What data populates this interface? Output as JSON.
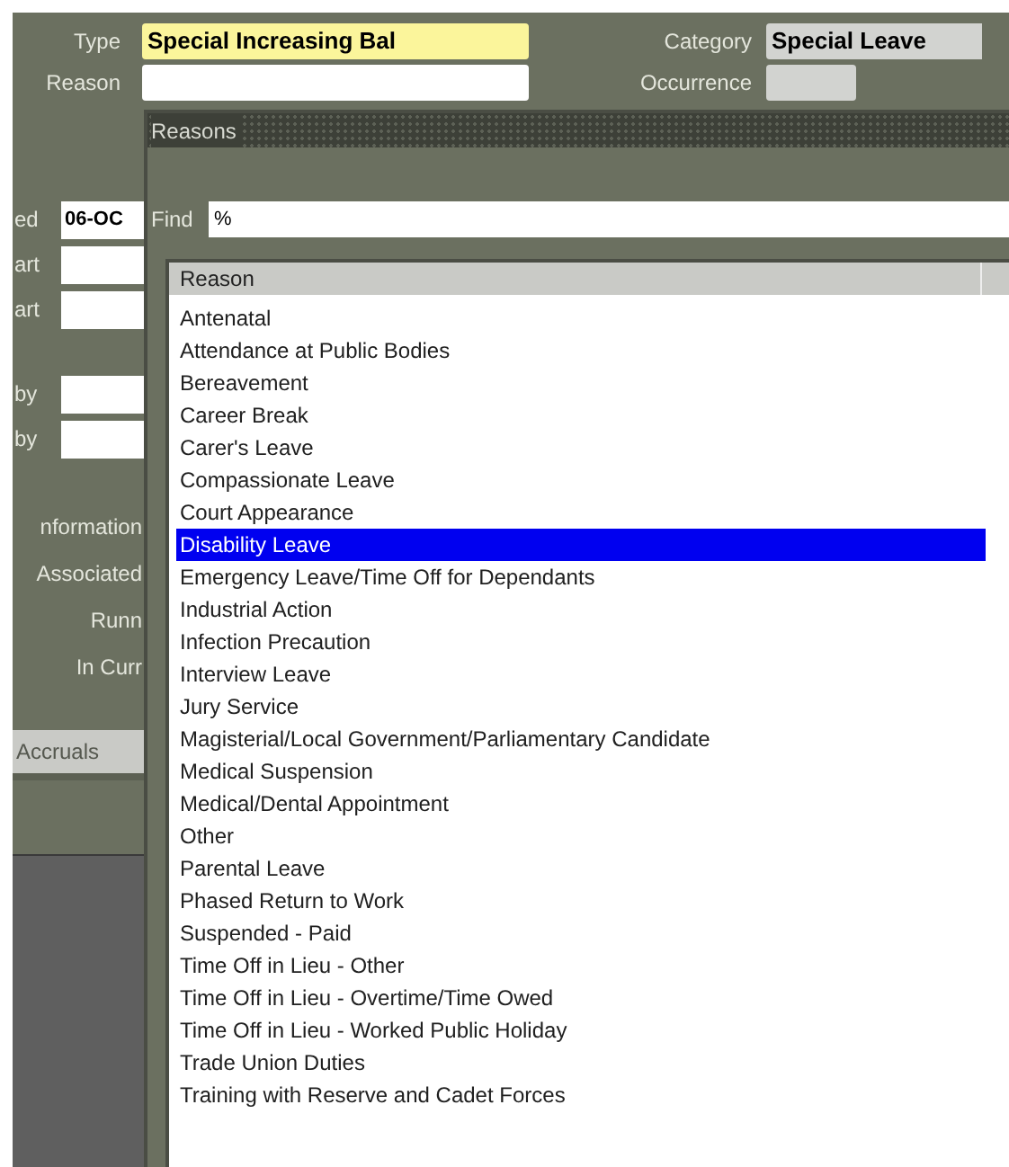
{
  "header": {
    "type_label": "Type",
    "type_value": "Special Increasing Bal",
    "category_label": "Category",
    "category_value": "Special Leave",
    "reason_label": "Reason",
    "occurrence_label": "Occurrence"
  },
  "left_panel": {
    "fields": [
      {
        "kind": "field",
        "label": "ed",
        "value": "06-OC"
      },
      {
        "kind": "field",
        "label": "art"
      },
      {
        "kind": "field",
        "label": "art"
      },
      {
        "kind": "gap"
      },
      {
        "kind": "field",
        "label": "by"
      },
      {
        "kind": "field",
        "label": "by"
      },
      {
        "kind": "gap"
      },
      {
        "kind": "text",
        "label": "nformation"
      },
      {
        "kind": "text",
        "label": "Associated"
      },
      {
        "kind": "text",
        "label": "Runn"
      },
      {
        "kind": "text",
        "label": "In Curr"
      }
    ],
    "tab": "Accruals"
  },
  "dialog": {
    "title": "Reasons",
    "find_label": "Find",
    "find_value": "%",
    "column": "Reason",
    "items": [
      {
        "label": "Antenatal",
        "selected": false
      },
      {
        "label": "Attendance at Public Bodies",
        "selected": false
      },
      {
        "label": "Bereavement",
        "selected": false
      },
      {
        "label": "Career Break",
        "selected": false
      },
      {
        "label": "Carer's Leave",
        "selected": false
      },
      {
        "label": "Compassionate Leave",
        "selected": false
      },
      {
        "label": "Court Appearance",
        "selected": false
      },
      {
        "label": "Disability Leave",
        "selected": true
      },
      {
        "label": "Emergency Leave/Time Off for Dependants",
        "selected": false
      },
      {
        "label": "Industrial Action",
        "selected": false
      },
      {
        "label": "Infection Precaution",
        "selected": false
      },
      {
        "label": "Interview Leave",
        "selected": false
      },
      {
        "label": "Jury Service",
        "selected": false
      },
      {
        "label": "Magisterial/Local Government/Parliamentary Candidate",
        "selected": false
      },
      {
        "label": "Medical Suspension",
        "selected": false
      },
      {
        "label": "Medical/Dental Appointment",
        "selected": false
      },
      {
        "label": "Other",
        "selected": false
      },
      {
        "label": "Parental Leave",
        "selected": false
      },
      {
        "label": "Phased Return to Work",
        "selected": false
      },
      {
        "label": "Suspended - Paid",
        "selected": false
      },
      {
        "label": "Time Off in Lieu - Other",
        "selected": false
      },
      {
        "label": "Time Off in Lieu - Overtime/Time Owed",
        "selected": false
      },
      {
        "label": "Time Off in Lieu - Worked Public Holiday",
        "selected": false
      },
      {
        "label": "Trade Union Duties",
        "selected": false
      },
      {
        "label": "Training with Reserve and Cadet Forces",
        "selected": false
      }
    ]
  }
}
